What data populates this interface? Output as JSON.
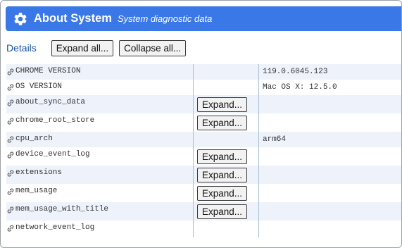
{
  "header": {
    "title": "About System",
    "subtitle": "System diagnostic data",
    "icon": "gear-icon",
    "color": "#3b78e7"
  },
  "toolbar": {
    "details_label": "Details",
    "expand_all_label": "Expand all...",
    "collapse_all_label": "Collapse all..."
  },
  "table": {
    "link_icon": "link-icon",
    "expand_label": "Expand...",
    "rows": [
      {
        "name": "CHROME VERSION",
        "value": "119.0.6045.123",
        "has_expand": false
      },
      {
        "name": "OS VERSION",
        "value": "Mac OS X: 12.5.0",
        "has_expand": false
      },
      {
        "name": "about_sync_data",
        "value": "",
        "has_expand": true
      },
      {
        "name": "chrome_root_store",
        "value": "",
        "has_expand": true
      },
      {
        "name": "cpu_arch",
        "value": "arm64",
        "has_expand": false
      },
      {
        "name": "device_event_log",
        "value": "",
        "has_expand": true
      },
      {
        "name": "extensions",
        "value": "",
        "has_expand": true
      },
      {
        "name": "mem_usage",
        "value": "",
        "has_expand": true
      },
      {
        "name": "mem_usage_with_title",
        "value": "",
        "has_expand": true
      },
      {
        "name": "network_event_log",
        "value": "",
        "has_expand": false
      }
    ]
  }
}
